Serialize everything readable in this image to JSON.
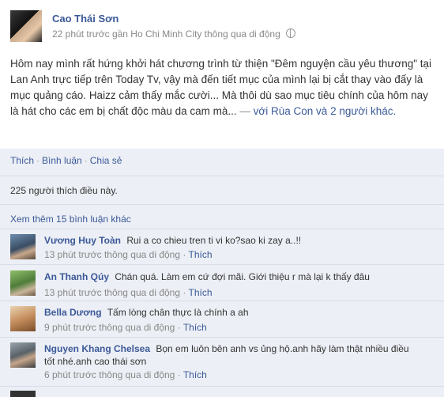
{
  "post": {
    "author": "Cao Thái Sơn",
    "meta": "22 phút trước gần Ho Chi Minh City thông qua di động",
    "text": "Hôm nay mình rất hứng khởi hát chương trình từ thiện \"Đêm nguyện cầu yêu thương\" tại Lan Anh trực tiếp trên Today Tv, vậy mà đến tiết mục của mình lại bị cắt thay vào đấy là mục quảng cáo. Haizz cảm thấy mắc cười... Mà thôi dù sao mục tiêu chính của hôm nay là hát cho các em bị chất độc màu da cam mà...",
    "with_dash": "—",
    "with_text": "với Rùa Con và 2 người khác."
  },
  "actions": {
    "like": "Thích",
    "comment": "Bình luận",
    "share": "Chia sẻ",
    "sep": "·"
  },
  "likes": {
    "text": "225 người thích điều này."
  },
  "more_comments": "Xem thêm 15 bình luận khác",
  "comments": [
    {
      "name": "Vương Huy Toàn",
      "text": "Rui a co chieu tren ti vi ko?sao ki zay a..!!",
      "time": "13 phút trước thông qua di động",
      "like": "Thích"
    },
    {
      "name": "An Thanh Qúy",
      "text": "Chán quá. Làm em cứ đợi mãi. Giới thiệu r mà lại k thấy đâu",
      "time": "13 phút trước thông qua di động",
      "like": "Thích"
    },
    {
      "name": "Bella Dương",
      "text": "Tấm lòng chân thực là chính a ah",
      "time": "9 phút trước thông qua di động",
      "like": "Thích"
    },
    {
      "name": "Nguyen Khang Chelsea",
      "text": "Bọn em luôn bên anh vs ủng hộ.anh hãy làm thật nhiều điều tốt nhé.anh cao thái sơn",
      "time": "6 phút trước thông qua di động",
      "like": "Thích"
    }
  ]
}
